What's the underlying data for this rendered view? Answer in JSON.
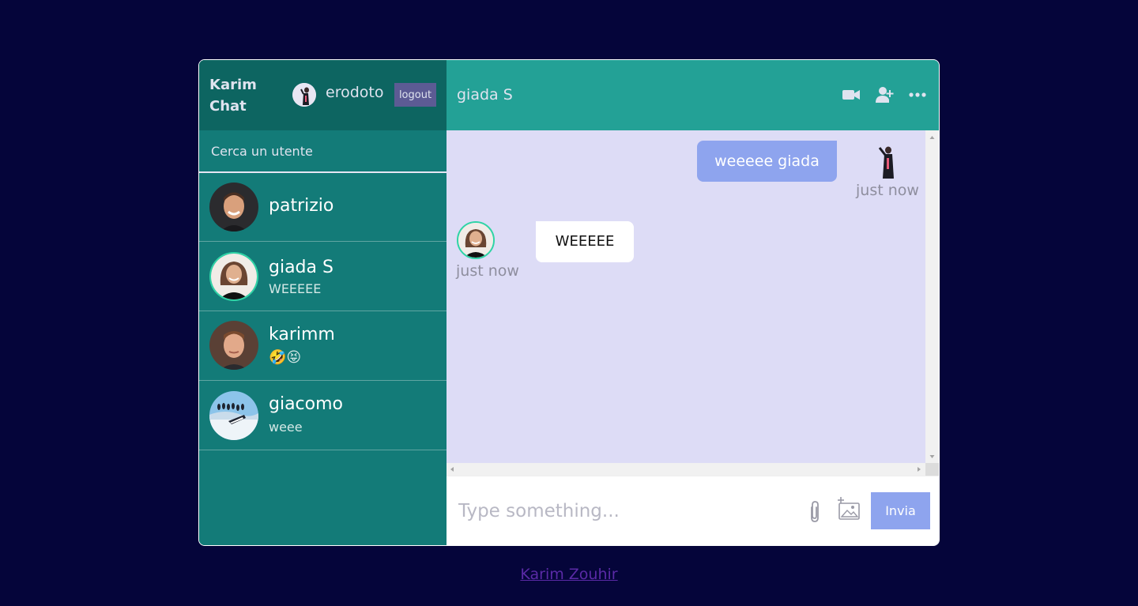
{
  "app": {
    "brand": "Karim Chat",
    "current_user": {
      "name": "erodoto",
      "avatar_icon": "user-photo-icon"
    },
    "logout_label": "logout"
  },
  "search": {
    "placeholder": "Cerca un utente"
  },
  "chats": [
    {
      "name": "patrizio",
      "last_message": "",
      "avatar_icon": "man-photo-icon",
      "active": false
    },
    {
      "name": "giada S",
      "last_message": "WEEEEE",
      "avatar_icon": "woman-photo-icon",
      "active": true
    },
    {
      "name": "karimm",
      "last_message": "🤣😝",
      "avatar_icon": "man-photo-icon",
      "active": false
    },
    {
      "name": "giacomo",
      "last_message": "weee",
      "avatar_icon": "penguins-photo-icon",
      "active": false
    }
  ],
  "conversation": {
    "title": "giada S",
    "header_icons": [
      "video-camera-icon",
      "add-user-icon",
      "more-dots-icon"
    ],
    "messages": [
      {
        "direction": "outgoing",
        "text": "weeeee giada",
        "time": "just now"
      },
      {
        "direction": "incoming",
        "text": "WEEEEE",
        "time": "just now"
      }
    ]
  },
  "composer": {
    "placeholder": "Type something...",
    "attach_icon": "paperclip-icon",
    "image_icon": "add-image-icon",
    "send_label": "Invia"
  },
  "footer": {
    "link_text": "Karim Zouhir"
  },
  "colors": {
    "page_bg": "#05053a",
    "sidebar_bg": "#137b78",
    "sidebar_header_bg": "#0d6561",
    "chat_header_bg": "#23a196",
    "messages_bg": "#dddcf6",
    "accent": "#8ea4ee",
    "logout_bg": "#5c5b94",
    "online_ring": "#2fd4a6"
  }
}
